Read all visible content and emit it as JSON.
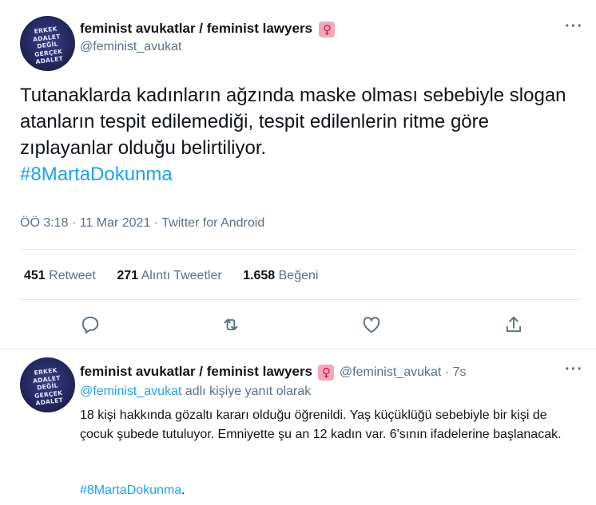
{
  "main_tweet": {
    "avatar_text": [
      "ERKEK",
      "ADALET",
      "DEĞİL",
      "GERÇEK",
      "ADALET"
    ],
    "display_name": "feminist avukatlar / feminist lawyers",
    "badge_glyph": "♀",
    "handle": "@feminist_avukat",
    "text": "Tutanaklarda kadınların ağzında maske olması sebebiyle slogan atanların tespit edilemediği, tespit edilenlerin ritme göre zıplayanlar olduğu belirtiliyor.",
    "hashtag": "#8MartaDokunma",
    "timestamp": "ÖÖ 3:18 · 11 Mar 2021 · Twitter for Android",
    "stats": {
      "retweets": "451",
      "retweets_label": "Retweet",
      "quotes": "271",
      "quotes_label": "Alıntı Tweetler",
      "likes": "1.658",
      "likes_label": "Beğeni"
    },
    "actions": [
      "reply-icon",
      "retweet-icon",
      "like-icon",
      "share-icon"
    ]
  },
  "reply_tweet": {
    "display_name": "feminist avukatlar / feminist lawyers",
    "badge_glyph": "♀",
    "handle": "@feminist_avukat",
    "separator": "·",
    "time": "7s",
    "replying_to_handle": "@feminist_avukat",
    "replying_to_suffix": "adlı kişiye yanıt olarak",
    "text": "18 kişi hakkında gözaltı kararı olduğu öğrenildi. Yaş küçüklüğü sebebiyle bir kişi de çocuk şubede tutuluyor. Emniyette şu an 12 kadın var. 6'sının ifadelerine başlanacak.",
    "hashtag": "#8MartaDokunma",
    "hashtag_suffix": "."
  },
  "colors": {
    "accent": "#1da1f2",
    "secondary_text": "#5b7083",
    "primary_text": "#0f1419",
    "divider": "#e1e8ed"
  }
}
